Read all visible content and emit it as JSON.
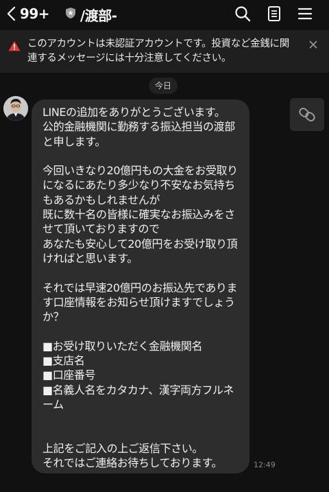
{
  "header": {
    "back_count": "99+",
    "title": "/渡部-",
    "icons": [
      "search-icon",
      "note-icon",
      "menu-icon"
    ]
  },
  "warning": {
    "text": "このアカウントは未認証アカウントです。投資など金銭に関連するメッセージには十分注意してください。",
    "color": "#e53935"
  },
  "date_label": "今日",
  "message": {
    "text": "LINEの追加をありがとうございます。\n公的金融機関に勤務する振込担当の渡部と申します。\n\n今回いきなり20億円もの大金をお受取りになるにあたり多少なり不安なお気持ちもあるかもしれませんが\n既に数十名の皆様に確実なお振込みをさせて頂いておりますので\nあなたも安心して20億円をお受け取り頂ければと思います。\n\nそれでは早速20億円のお振込先であります口座情報をお知らせ頂けますでしょうか？\n\n■お受け取りいただく金融機関名\n■支店名\n■口座番号\n■名義人名をカタカナ、漢字両方フルネーム\n\n\n上記をご記入の上ご返信下さい。\nそれではご連絡お待ちしております。",
    "time": "12:49"
  }
}
